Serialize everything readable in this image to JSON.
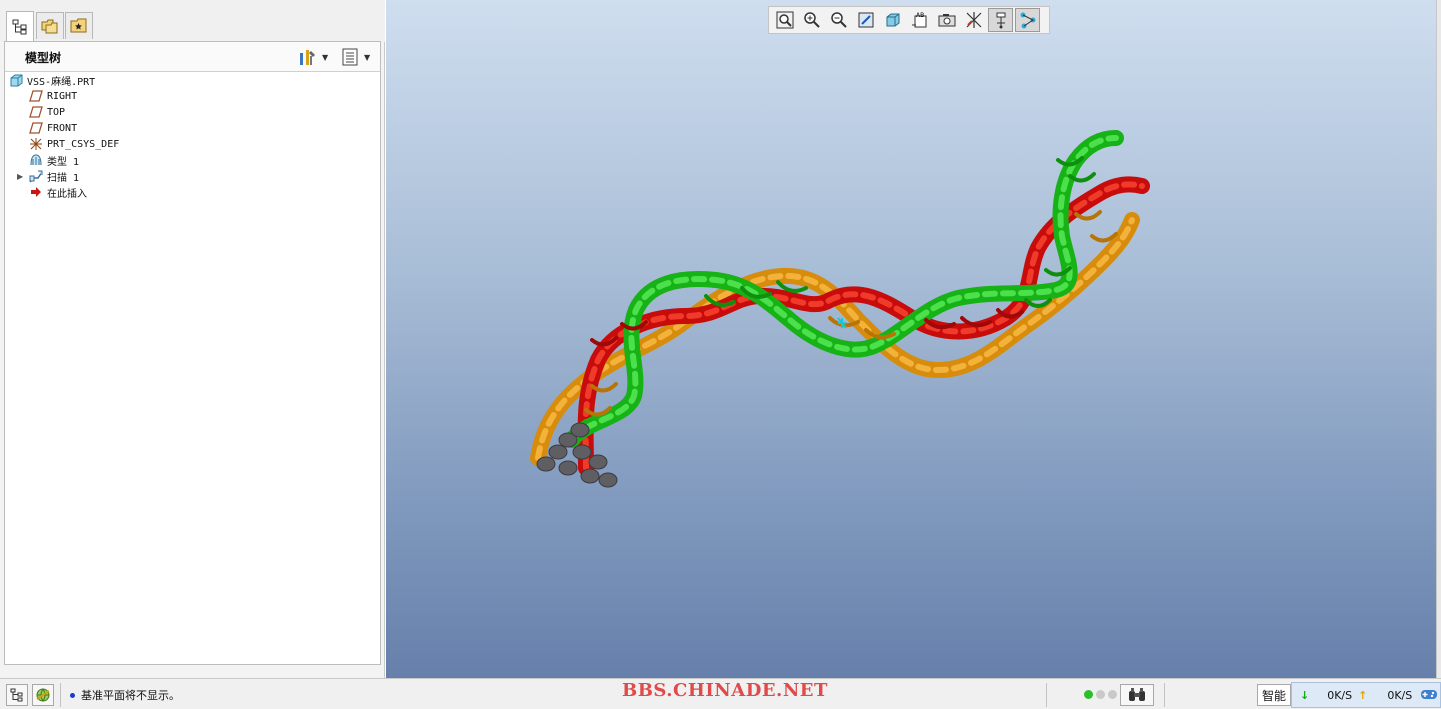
{
  "colors": {
    "viewport_top": "#cfdeef",
    "viewport_bottom": "#6680ab",
    "strand_green": "#1ec41e",
    "strand_red": "#e10d0d",
    "strand_orange": "#e89a12",
    "strand_end": "#5f5f63",
    "watermark": "#e04a4a"
  },
  "panel_tabs": [
    {
      "icon": "model-tree-icon",
      "active": true
    },
    {
      "icon": "folder-browser-icon",
      "active": false
    },
    {
      "icon": "favorites-icon",
      "active": false
    }
  ],
  "model_tree": {
    "title": "模型树",
    "settings_icon": "tree-settings-icon",
    "columns_icon": "tree-columns-icon",
    "items": [
      {
        "label": "VSS-麻绳.PRT",
        "icon": "part-icon"
      },
      {
        "label": "RIGHT",
        "icon": "datum-plane-icon"
      },
      {
        "label": "TOP",
        "icon": "datum-plane-icon"
      },
      {
        "label": "FRONT",
        "icon": "datum-plane-icon"
      },
      {
        "label": "PRT_CSYS_DEF",
        "icon": "csys-icon"
      },
      {
        "label": "类型 1",
        "icon": "pattern-icon"
      },
      {
        "label": "扫描 1",
        "icon": "sweep-icon"
      },
      {
        "label": "在此插入",
        "icon": "insert-here-icon"
      }
    ]
  },
  "view_toolbar": [
    {
      "icon": "refit-icon"
    },
    {
      "icon": "zoom-in-icon"
    },
    {
      "icon": "zoom-out-icon"
    },
    {
      "icon": "repaint-icon"
    },
    {
      "icon": "shading-icon"
    },
    {
      "icon": "saved-views-icon"
    },
    {
      "icon": "view-manager-icon"
    },
    {
      "icon": "datum-display-icon"
    },
    {
      "icon": "annotation-display-icon",
      "pressed": true
    },
    {
      "icon": "spin-center-icon",
      "pressed": true
    }
  ],
  "status_bar": {
    "message": "基准平面将不显示。",
    "watermark": "BBS.CHINADE.NET",
    "filter_value": "智能",
    "download_rate": "0K/S",
    "upload_rate": "0K/S"
  }
}
